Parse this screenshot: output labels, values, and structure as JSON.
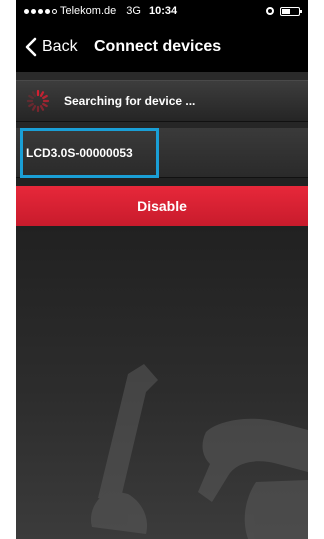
{
  "status_bar": {
    "carrier": "Telekom.de",
    "network": "3G",
    "time": "10:34"
  },
  "nav": {
    "back_label": "Back",
    "title": "Connect devices"
  },
  "search": {
    "status_text": "Searching for device ..."
  },
  "devices": [
    {
      "name": "LCD3.0S-00000053"
    }
  ],
  "actions": {
    "disable_label": "Disable"
  },
  "colors": {
    "accent_red": "#d62032",
    "highlight_blue": "#1a9fd6"
  },
  "icons": {
    "back": "chevron-left-icon",
    "spinner": "spinner-icon",
    "background_art": "wrench-icon"
  }
}
